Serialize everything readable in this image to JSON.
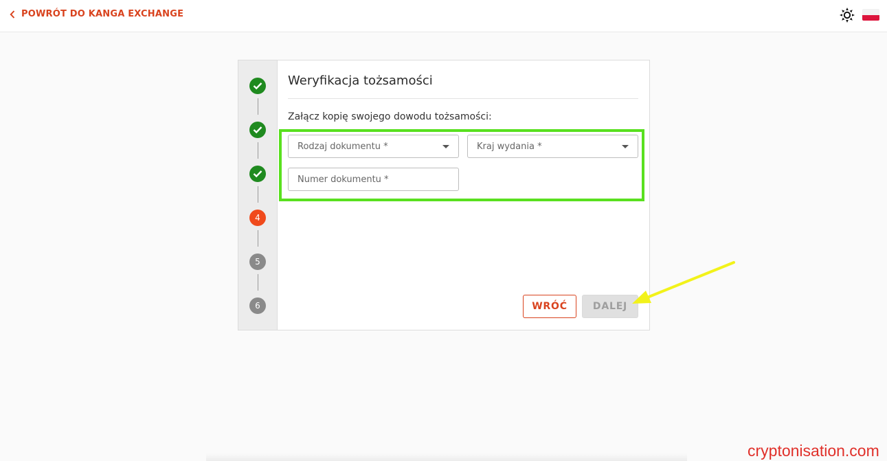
{
  "header": {
    "back_link_label": "POWRÓT DO KANGA EXCHANGE",
    "theme_icon": "sun-icon",
    "language_flag": "poland-flag"
  },
  "stepper": {
    "steps": [
      {
        "label": "",
        "state": "done"
      },
      {
        "label": "",
        "state": "done"
      },
      {
        "label": "",
        "state": "done"
      },
      {
        "label": "4",
        "state": "active"
      },
      {
        "label": "5",
        "state": "todo"
      },
      {
        "label": "6",
        "state": "todo"
      }
    ]
  },
  "form": {
    "title": "Weryfikacja tożsamości",
    "instruction": "Załącz kopię swojego dowodu tożsamości:",
    "document_type_placeholder": "Rodzaj dokumentu *",
    "issuing_country_placeholder": "Kraj wydania *",
    "document_number_placeholder": "Numer dokumentu *",
    "back_button": "WRÓĆ",
    "next_button": "DALEJ"
  },
  "watermark": "cryptonisation.com",
  "colors": {
    "accent": "#d9431e",
    "step_done": "#1f8a1f",
    "step_active": "#f04a1c",
    "step_todo": "#8a8a8a",
    "highlight_box": "#59e01f",
    "annotation_arrow": "#f2f21a"
  }
}
